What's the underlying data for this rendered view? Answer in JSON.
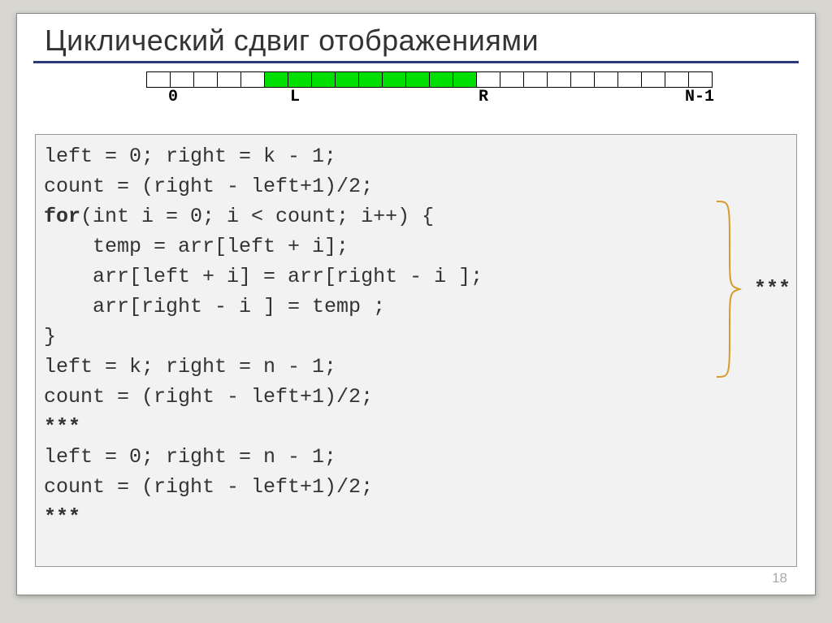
{
  "title": "Циклический сдвиг отображениями",
  "labels": {
    "zero": "0",
    "L": "L",
    "R": "R",
    "Nminus1": "N-1"
  },
  "array": {
    "totalCells": 24,
    "greenStart": 5,
    "greenEnd": 13
  },
  "code": {
    "l1": "left = 0; right = k - 1;",
    "l2": "count = (right - left+1)/2;",
    "l3a": "for",
    "l3b": "(int i = 0; i < count; i++) {",
    "l4": "    temp = arr[left + i];",
    "l5": "    arr[left + i] = arr[right - i ];",
    "l6": "    arr[right - i ] = temp ;",
    "l7": "}",
    "l8": "left = k; right = n - 1;",
    "l9": "count = (right - left+1)/2;",
    "l10": "***",
    "l11": "left = 0; right = n - 1;",
    "l12": "count = (right - left+1)/2;",
    "l13": "***"
  },
  "sideStars": "***",
  "pageNumber": "18"
}
